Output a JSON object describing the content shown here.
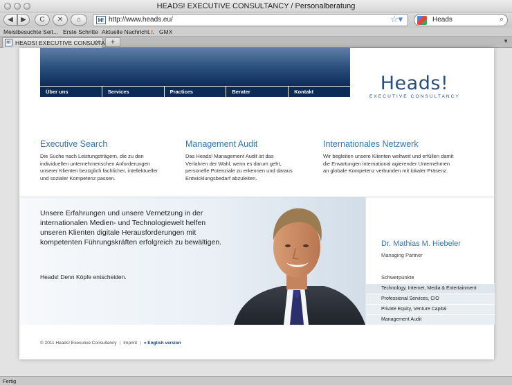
{
  "window": {
    "title": "HEADS! EXECUTIVE CONSULTANCY / Personalberatung"
  },
  "toolbar": {
    "back": "◀",
    "forward": "▶",
    "reload": "C",
    "stop": "✕",
    "home": "⌂",
    "url": "http://www.heads.eu/",
    "favicon": "H!",
    "search_value": "Heads"
  },
  "bookmarks": [
    "Meistbesuchte Seit...",
    "Erste Schritte",
    "Aktuelle Nachricht...",
    "GMX"
  ],
  "tab": {
    "label": "HEADS! EXECUTIVE CONSULTANC...",
    "new_tab": "+"
  },
  "nav": [
    "Über uns",
    "Services",
    "Practices",
    "Berater",
    "Kontakt"
  ],
  "logo": {
    "main": "Heads!",
    "sub": "EXECUTIVE CONSULTANCY"
  },
  "columns": [
    {
      "title": "Executive Search",
      "text": "Die Suche nach Leistungsträgern, die zu den individuellen unternehmerischen Anforderungen unserer Klienten bezüglich fachlicher, intellektueller und sozialer Kompetenz passen."
    },
    {
      "title": "Management Audit",
      "text": "Das Heads! Management Audit ist das Verfahren der Wahl, wenn es darum geht, personelle Potenziale zu erkennen und daraus Entwicklungsbedarf abzuleiten."
    },
    {
      "title": "Internationales Netzwerk",
      "text": "Wir begleiten unsere Klienten weltweit und erfüllen damit die Erwartungen international agierender Unternehmen an globale Kompetenz verbunden mit lokaler Präsenz."
    }
  ],
  "hero": {
    "text": "Unsere Erfahrungen und unsere Vernetzung in der internationalen Medien- und Technologiewelt helfen unseren Klienten digitale Herausforderungen mit kompetenten Führungskräften erfolgreich zu bewältigen.",
    "slogan": "Heads! Denn Köpfe entscheiden."
  },
  "profile": {
    "name": "Dr. Mathias M. Hiebeler",
    "role": "Managing Partner",
    "focus_title": "Schwerpunkte",
    "focus": [
      "Technology, Internet, Media & Entertainment",
      "Professional Services, CIO",
      "Private Equity, Venture Capital",
      "Management Audit"
    ]
  },
  "footer": {
    "copyright": "© 2011 Heads! Executive Consultancy",
    "sep": "|",
    "imprint": "Imprint",
    "english": "» English version"
  },
  "status": "Fertig",
  "colors": {
    "navy": "#0b2a55",
    "accent_blue": "#2f75b5",
    "accent_orange": "#f08a1c"
  }
}
